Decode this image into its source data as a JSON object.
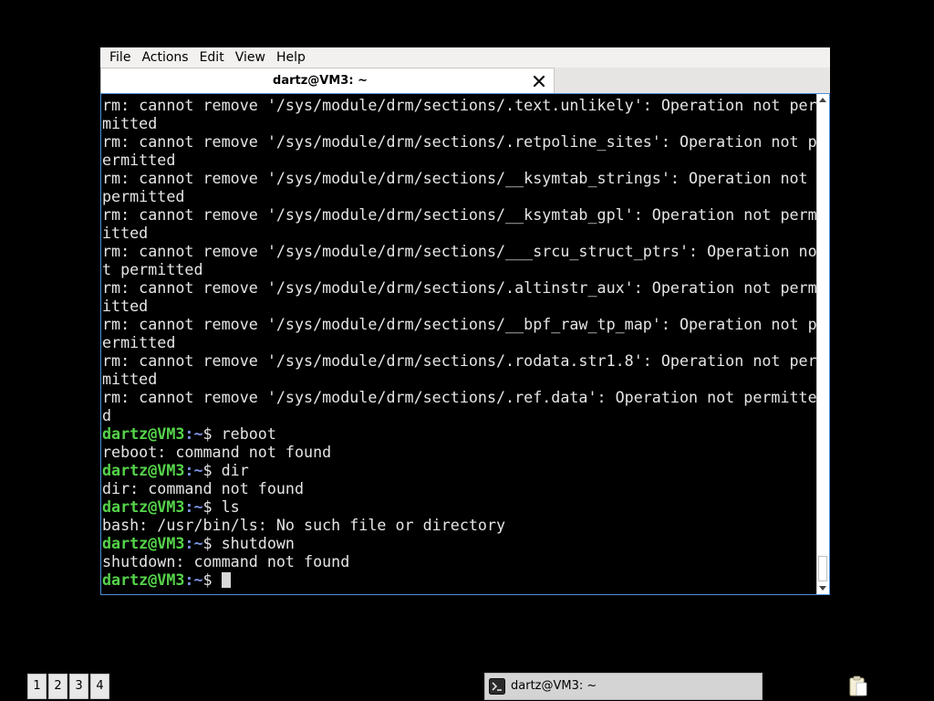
{
  "menubar": {
    "file": "File",
    "actions": "Actions",
    "edit": "Edit",
    "view": "View",
    "help": "Help"
  },
  "tab": {
    "title": "dartz@VM3: ~",
    "close_icon": "close-icon"
  },
  "terminal": {
    "lines": [
      {
        "type": "out",
        "text": "rm: cannot remove '/sys/module/drm/sections/.text.unlikely': Operation not per"
      },
      {
        "type": "out",
        "text": "mitted"
      },
      {
        "type": "out",
        "text": "rm: cannot remove '/sys/module/drm/sections/.retpoline_sites': Operation not p"
      },
      {
        "type": "out",
        "text": "ermitted"
      },
      {
        "type": "out",
        "text": "rm: cannot remove '/sys/module/drm/sections/__ksymtab_strings': Operation not "
      },
      {
        "type": "out",
        "text": "permitted"
      },
      {
        "type": "out",
        "text": "rm: cannot remove '/sys/module/drm/sections/__ksymtab_gpl': Operation not perm"
      },
      {
        "type": "out",
        "text": "itted"
      },
      {
        "type": "out",
        "text": "rm: cannot remove '/sys/module/drm/sections/___srcu_struct_ptrs': Operation no"
      },
      {
        "type": "out",
        "text": "t permitted"
      },
      {
        "type": "out",
        "text": "rm: cannot remove '/sys/module/drm/sections/.altinstr_aux': Operation not perm"
      },
      {
        "type": "out",
        "text": "itted"
      },
      {
        "type": "out",
        "text": "rm: cannot remove '/sys/module/drm/sections/__bpf_raw_tp_map': Operation not p"
      },
      {
        "type": "out",
        "text": "ermitted"
      },
      {
        "type": "out",
        "text": "rm: cannot remove '/sys/module/drm/sections/.rodata.str1.8': Operation not per"
      },
      {
        "type": "out",
        "text": "mitted"
      },
      {
        "type": "out",
        "text": "rm: cannot remove '/sys/module/drm/sections/.ref.data': Operation not permitte"
      },
      {
        "type": "out",
        "text": "d"
      },
      {
        "type": "prompt",
        "user": "dartz@VM3",
        "path": ":~",
        "sym": "$ ",
        "cmd": "reboot"
      },
      {
        "type": "out",
        "text": "reboot: command not found"
      },
      {
        "type": "prompt",
        "user": "dartz@VM3",
        "path": ":~",
        "sym": "$ ",
        "cmd": "dir"
      },
      {
        "type": "out",
        "text": "dir: command not found"
      },
      {
        "type": "prompt",
        "user": "dartz@VM3",
        "path": ":~",
        "sym": "$ ",
        "cmd": "ls"
      },
      {
        "type": "out",
        "text": "bash: /usr/bin/ls: No such file or directory"
      },
      {
        "type": "prompt",
        "user": "dartz@VM3",
        "path": ":~",
        "sym": "$ ",
        "cmd": "shutdown"
      },
      {
        "type": "out",
        "text": "shutdown: command not found"
      },
      {
        "type": "prompt",
        "user": "dartz@VM3",
        "path": ":~",
        "sym": "$ ",
        "cmd": "",
        "cursor": true
      }
    ],
    "colors": {
      "background": "#000000",
      "foreground": "#e5e5e5",
      "prompt_user": "#55d34a",
      "prompt_path": "#7c93e6"
    }
  },
  "taskbar": {
    "workspaces": [
      "1",
      "2",
      "3",
      "4"
    ],
    "task_label": "dartz@VM3: ~",
    "task_icon": "terminal-icon",
    "tray_icon": "clipboard-icon"
  }
}
